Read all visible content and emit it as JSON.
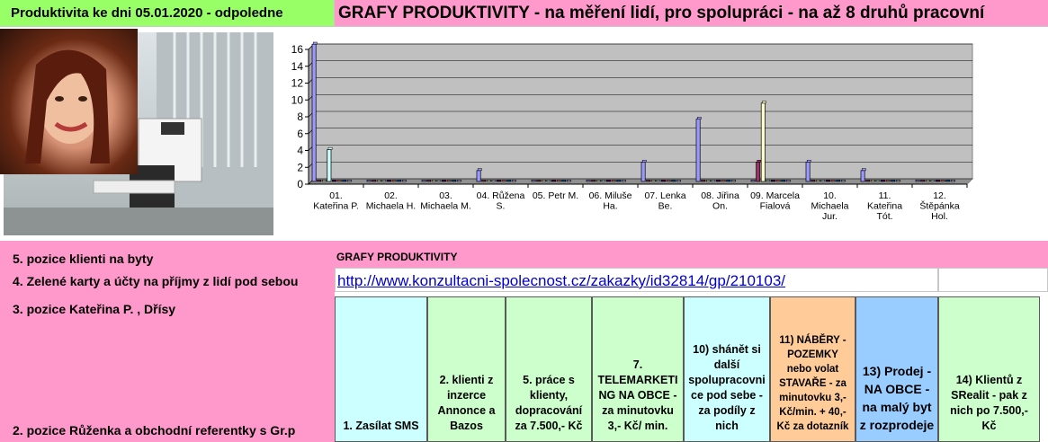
{
  "header": {
    "left_title": "Produktivita ke dni 05.01.2020 - odpoledne",
    "right_title": "GRAFY PRODUKTIVITY - na měření lidí, pro spolupráci - na až 8 druhů pracovní"
  },
  "chart_data": {
    "type": "bar",
    "categories": [
      "01. Kateřina P.",
      "02. Michaela H.",
      "03. Michaela M.",
      "04. Růžena S.",
      "05. Petr M.",
      "06. Miluše Ha.",
      "07. Lenka Be.",
      "08. Jiřina On.",
      "09. Marcela Fialová",
      "10. Michaela Jur.",
      "11. Kateřina Tót.",
      "12. Štěpánka Hol."
    ],
    "ylim": [
      0,
      16
    ],
    "yticks": [
      0,
      2,
      4,
      6,
      8,
      10,
      12,
      14,
      16
    ],
    "grid": true,
    "series": [
      {
        "color": "#9999ff",
        "values": [
          16.3,
          0,
          0,
          1.3,
          0,
          0,
          2.3,
          7.4,
          0,
          2.3,
          1.3,
          0
        ]
      },
      {
        "color": "#993366",
        "values": [
          0,
          0,
          0,
          0,
          0,
          0,
          0,
          0,
          2.3,
          0,
          0,
          0
        ]
      },
      {
        "color": "#ffffcc",
        "values": [
          0,
          0,
          0,
          0,
          0,
          0,
          0,
          0,
          9.3,
          0,
          0,
          0
        ]
      },
      {
        "color": "#ccffff",
        "values": [
          3.8,
          0,
          0,
          0,
          0,
          0,
          0,
          0,
          0,
          0,
          0,
          0
        ]
      },
      {
        "color": "#660066",
        "values": [
          0,
          0,
          0,
          0,
          0,
          0,
          0,
          0,
          0,
          0,
          0,
          0
        ]
      },
      {
        "color": "#ff8080",
        "values": [
          0,
          0,
          0,
          0,
          0,
          0,
          0,
          0,
          0,
          0,
          0,
          0
        ]
      },
      {
        "color": "#0066cc",
        "values": [
          0,
          0,
          0,
          0,
          0,
          0,
          0,
          0,
          0,
          0,
          0,
          0
        ]
      },
      {
        "color": "#ccccff",
        "values": [
          0,
          0,
          0,
          0,
          0,
          0,
          0,
          0,
          0,
          0,
          0,
          0
        ]
      }
    ]
  },
  "positions": {
    "p5": "5. pozice  klienti na byty",
    "p4": "4. Zelené karty a účty na příjmy z lidí pod sebou",
    "p3": "3. pozice Kateřina P. , Dřísy",
    "p2": "2. pozice Růženka a obchodní referentky s Gr.p"
  },
  "grafy_label": "GRAFY  PRODUKTIVITY",
  "link_text": "http://www.konzultacni-spolecnost.cz/zakazky/id32814/gp/210103/",
  "columns": [
    {
      "label": "1. Zasílat SMS",
      "bg": "#ccffff"
    },
    {
      "label": "2. klienti z inzerce Annonce a Bazos",
      "bg": "#ccffcc"
    },
    {
      "label": "5. práce s klienty, dopracování za 7.500,- Kč",
      "bg": "#ccffcc"
    },
    {
      "label": "7. TELEMARKETI NG NA OBCE - za minutovku 3,- Kč/ min.",
      "bg": "#ccffcc"
    },
    {
      "label": "10) shánět si další spolupracovni ce pod sebe - za podíly z nich",
      "bg": "#ccffff"
    },
    {
      "label": "11) NÁBĚRY - POZEMKY nebo volat STAVAŘE - za minutovku 3,- Kč/min. + 40,- Kč za dotazník",
      "bg": "#ffcc99"
    },
    {
      "label": "13) Prodej - NA OBCE - na malý byt z rozprodeje",
      "bg": "#99ccff"
    },
    {
      "label": "14) Klientů z SRealit - pak z nich po 7.500,- Kč",
      "bg": "#ccffcc"
    }
  ]
}
